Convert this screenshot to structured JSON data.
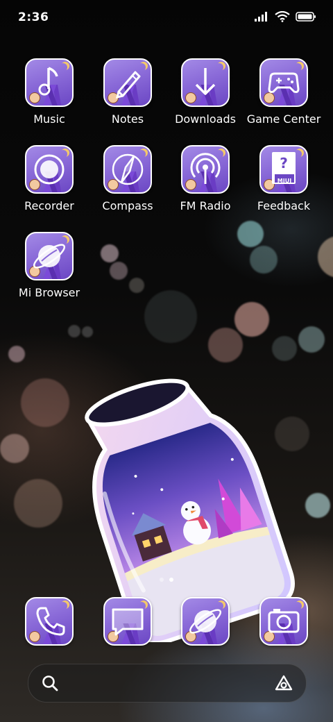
{
  "status_bar": {
    "time": "2:36"
  },
  "apps": [
    {
      "label": "Music",
      "icon": "music-note-icon"
    },
    {
      "label": "Notes",
      "icon": "pencil-icon"
    },
    {
      "label": "Downloads",
      "icon": "download-arrow-icon"
    },
    {
      "label": "Game Center",
      "icon": "gamepad-icon"
    },
    {
      "label": "Recorder",
      "icon": "record-circle-icon"
    },
    {
      "label": "Compass",
      "icon": "compass-icon"
    },
    {
      "label": "FM Radio",
      "icon": "radio-signal-icon"
    },
    {
      "label": "Feedback",
      "icon": "feedback-question-icon",
      "badge_text": "MIUI"
    },
    {
      "label": "Mi Browser",
      "icon": "browser-planet-icon"
    }
  ],
  "dock": [
    {
      "icon": "phone-icon"
    },
    {
      "icon": "messages-icon"
    },
    {
      "icon": "browser-planet-icon"
    },
    {
      "icon": "camera-icon"
    }
  ],
  "feedback_icon_text": "?",
  "colors": {
    "icon_purple": "#8a6ad8",
    "icon_border": "#ffffff",
    "moon": "#f3c86a"
  }
}
